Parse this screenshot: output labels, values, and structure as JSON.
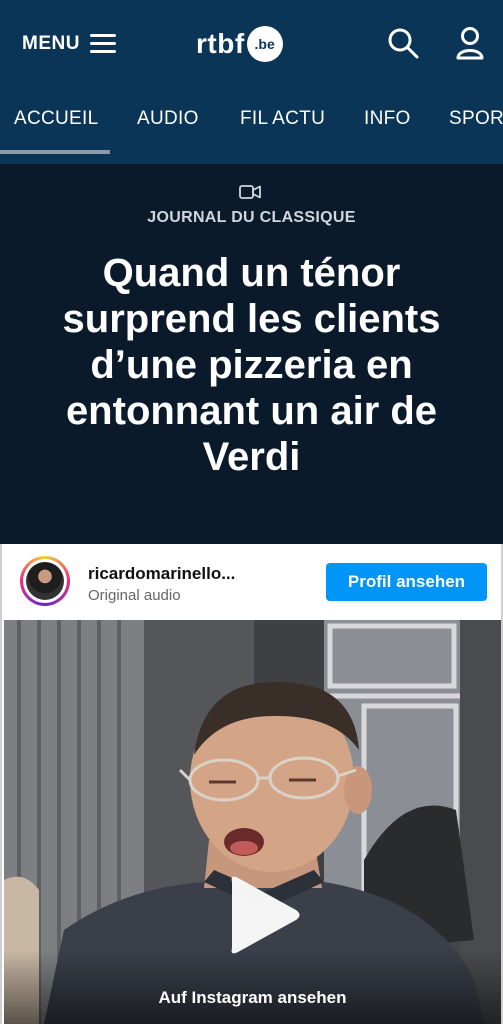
{
  "header": {
    "menu_label": "MENU",
    "logo_text": "rtbf",
    "logo_badge": ".be"
  },
  "nav": {
    "items": [
      {
        "label": "ACCUEIL",
        "active": true
      },
      {
        "label": "AUDIO"
      },
      {
        "label": "FIL ACTU"
      },
      {
        "label": "INFO"
      },
      {
        "label": "SPOR"
      }
    ]
  },
  "article": {
    "media_icon": "video-camera-icon",
    "category": "JOURNAL DU CLASSIQUE",
    "headline": "Quand un ténor surprend les clients d’une pizzeria en entonnant un air de Verdi"
  },
  "instagram_embed": {
    "username": "ricardomarinello...",
    "subtitle": "Original audio",
    "profile_button": "Profil ansehen",
    "watch_link": "Auf Instagram ansehen",
    "accent_color": "#0095f6"
  },
  "colors": {
    "topbar": "#0a3557",
    "page_background": "#0b1a2b"
  }
}
